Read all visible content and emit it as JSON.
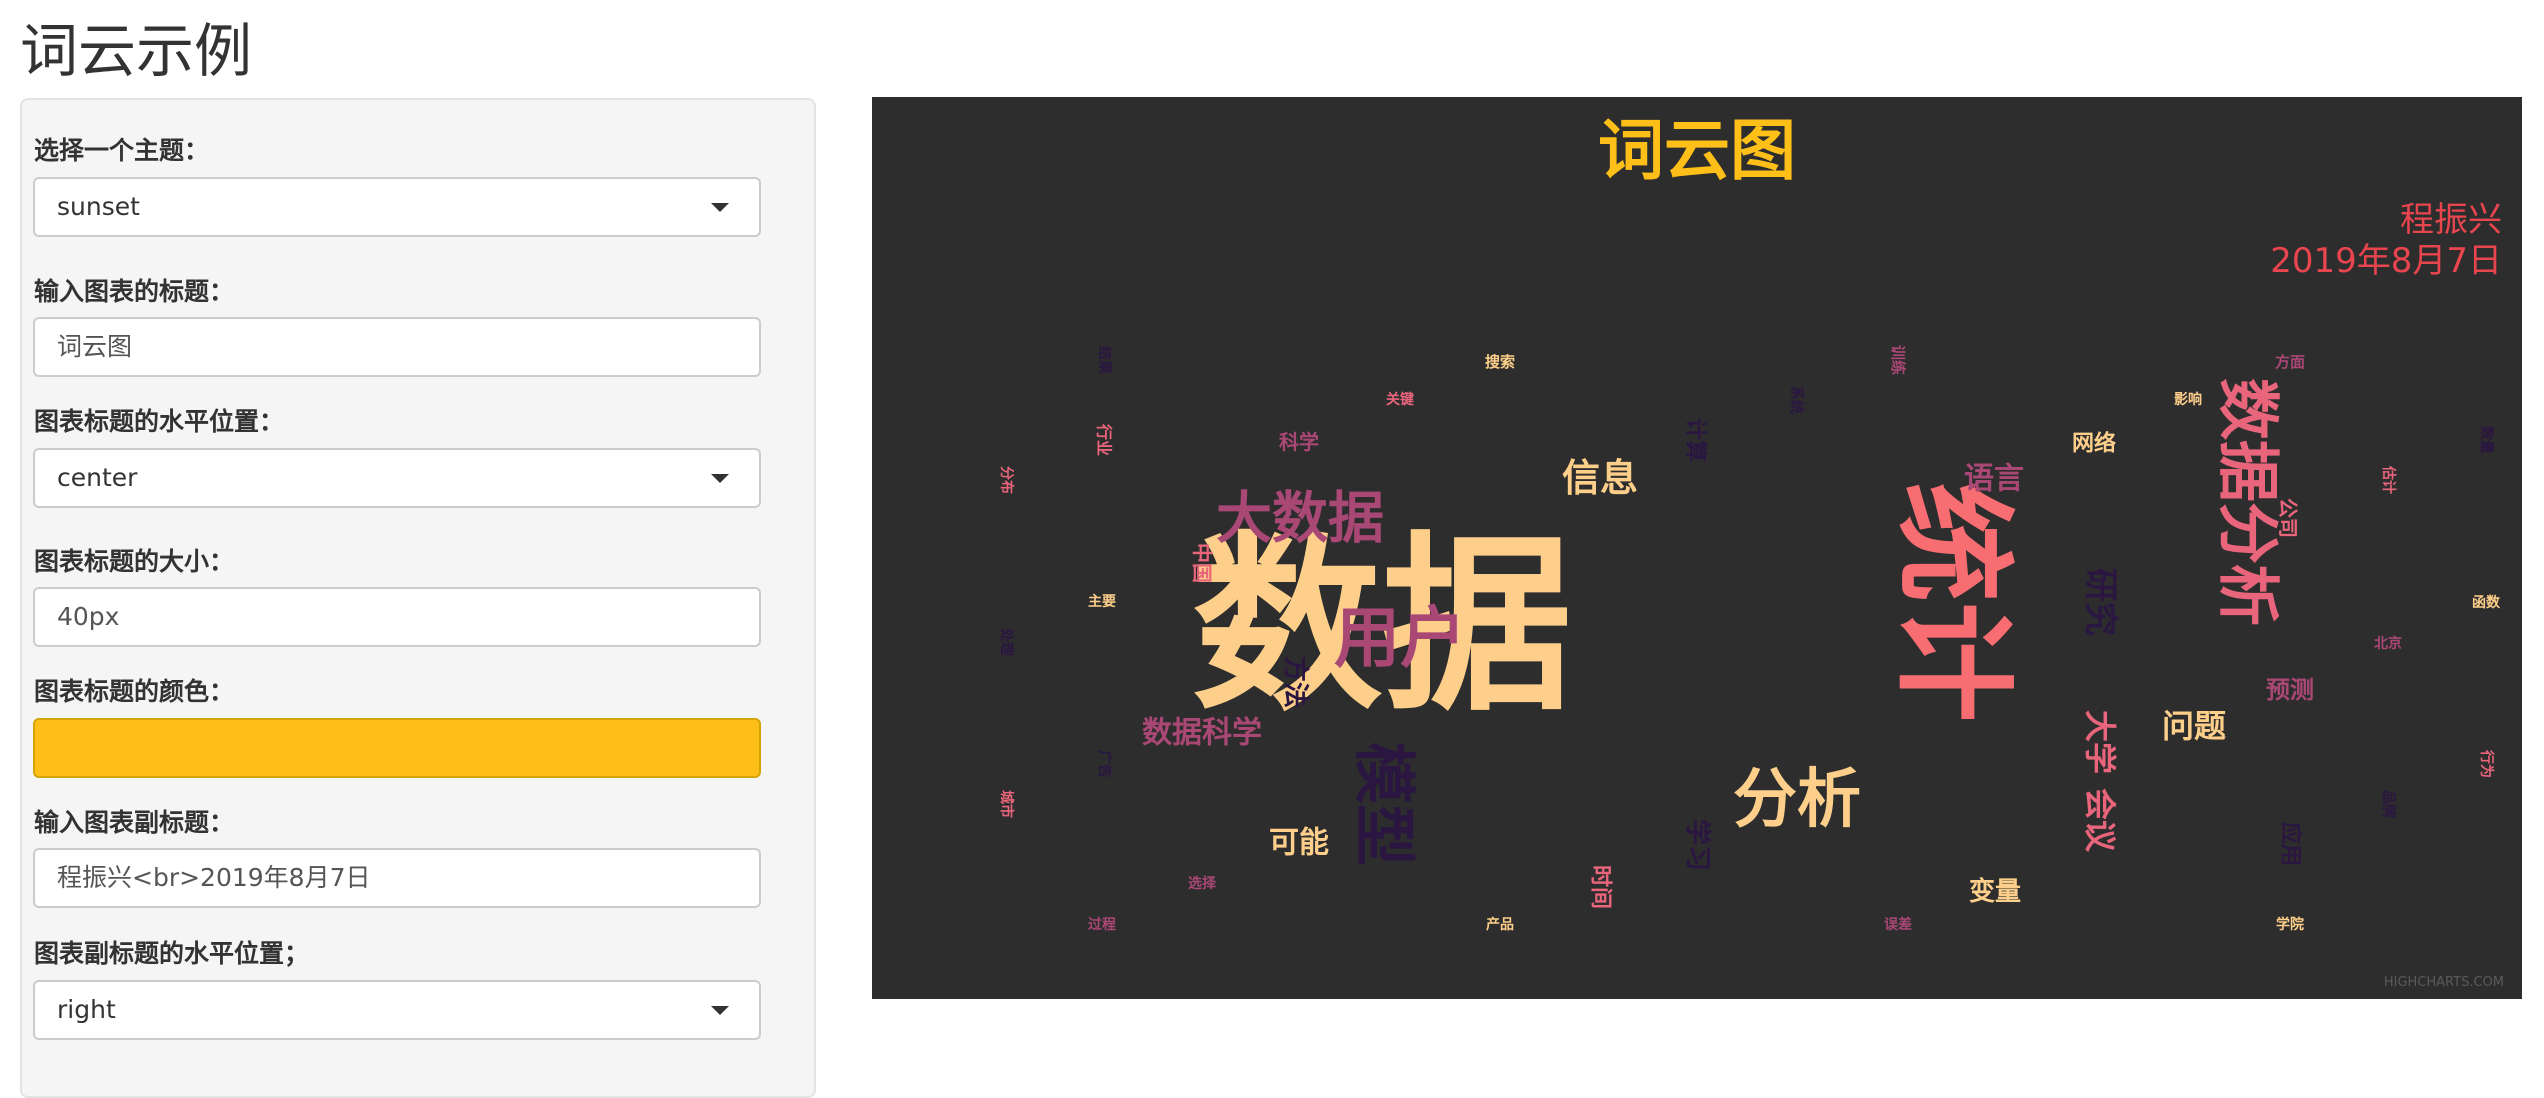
{
  "app": {
    "title": "词云示例"
  },
  "form": {
    "theme": {
      "label": "选择一个主题：",
      "value": "sunset"
    },
    "title_input": {
      "label": "输入图表的标题：",
      "value": "词云图"
    },
    "title_align": {
      "label": "图表标题的水平位置：",
      "value": "center"
    },
    "title_size": {
      "label": "图表标题的大小：",
      "value": "40px"
    },
    "title_color": {
      "label": "图表标题的颜色：",
      "value": "#FFBF19"
    },
    "subtitle_input": {
      "label": "输入图表副标题：",
      "value": "程振兴<br>2019年8月7日"
    },
    "subtitle_align": {
      "label": "图表副标题的水平位置；",
      "value": "right"
    }
  },
  "chart_data": {
    "type": "wordcloud",
    "title": "词云图",
    "subtitle_lines": [
      "程振兴",
      "2019年8月7日"
    ],
    "credits": "HIGHCHARTS.COM",
    "background": "#2d2d2d",
    "title_color": "#FFBF19",
    "subtitle_color": "#e8454f",
    "words": [
      {
        "text": "数据",
        "color": "#fdcf8a"
      },
      {
        "text": "统计",
        "color": "#f76d72"
      },
      {
        "text": "数据分析",
        "color": "#e9657c"
      },
      {
        "text": "用户",
        "color": "#a94775"
      },
      {
        "text": "模型",
        "color": "#2a1640"
      },
      {
        "text": "大数据",
        "color": "#a94775"
      },
      {
        "text": "分析",
        "color": "#fdcf8a"
      },
      {
        "text": "大学",
        "color": "#e9657c"
      },
      {
        "text": "会议",
        "color": "#e9657c"
      },
      {
        "text": "研究",
        "color": "#2a1640"
      },
      {
        "text": "信息",
        "color": "#fdcf8a"
      },
      {
        "text": "数据科学",
        "color": "#a94775"
      },
      {
        "text": "语言",
        "color": "#a94775"
      },
      {
        "text": "问题",
        "color": "#fdcf8a"
      },
      {
        "text": "可能",
        "color": "#fdcf8a"
      },
      {
        "text": "方法",
        "color": "#2a1640"
      },
      {
        "text": "学习",
        "color": "#2a1640"
      },
      {
        "text": "变量",
        "color": "#fdcf8a"
      },
      {
        "text": "预测",
        "color": "#a94775"
      },
      {
        "text": "网络",
        "color": "#fdcf8a"
      },
      {
        "text": "计算",
        "color": "#2a1640"
      },
      {
        "text": "时间",
        "color": "#e9657c"
      },
      {
        "text": "应用",
        "color": "#2a1640"
      },
      {
        "text": "科学",
        "color": "#a94775"
      },
      {
        "text": "中国",
        "color": "#e9657c"
      },
      {
        "text": "公司",
        "color": "#e9657c"
      },
      {
        "text": "行业",
        "color": "#e9657c"
      },
      {
        "text": "搜索",
        "color": "#fdcf8a"
      },
      {
        "text": "训练",
        "color": "#a94775"
      },
      {
        "text": "方面",
        "color": "#a94775"
      },
      {
        "text": "关键",
        "color": "#e9657c"
      },
      {
        "text": "系统",
        "color": "#2a1640"
      },
      {
        "text": "影响",
        "color": "#fdcf8a"
      },
      {
        "text": "结果",
        "color": "#2a1640"
      },
      {
        "text": "分布",
        "color": "#e9657c"
      },
      {
        "text": "主要",
        "color": "#fdcf8a"
      },
      {
        "text": "估计",
        "color": "#e9657c"
      },
      {
        "text": "函数",
        "color": "#fdcf8a"
      },
      {
        "text": "北京",
        "color": "#a94775"
      },
      {
        "text": "数量",
        "color": "#2a1640"
      },
      {
        "text": "处理",
        "color": "#2a1640"
      },
      {
        "text": "广告",
        "color": "#2a1640"
      },
      {
        "text": "城市",
        "color": "#e9657c"
      },
      {
        "text": "选择",
        "color": "#a94775"
      },
      {
        "text": "过程",
        "color": "#a94775"
      },
      {
        "text": "产品",
        "color": "#fdcf8a"
      },
      {
        "text": "误差",
        "color": "#a94775"
      },
      {
        "text": "学院",
        "color": "#fdcf8a"
      },
      {
        "text": "行为",
        "color": "#e9657c"
      },
      {
        "text": "品牌",
        "color": "#2a1640"
      }
    ]
  }
}
